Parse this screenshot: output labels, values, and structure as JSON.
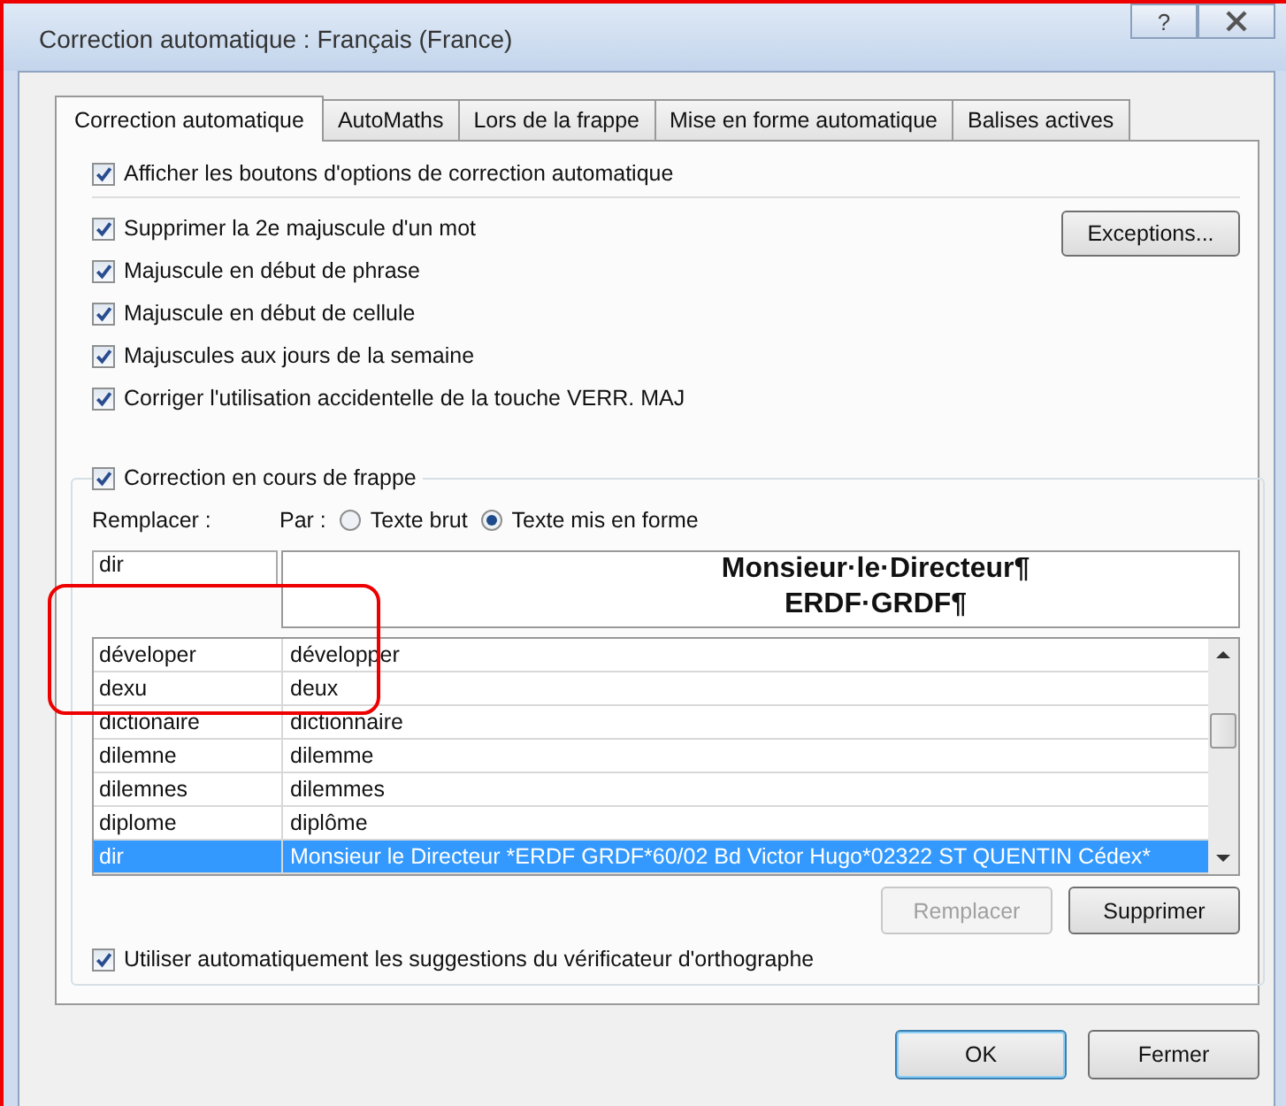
{
  "window": {
    "title": "Correction automatique : Français (France)",
    "help": "?"
  },
  "tabs": [
    {
      "label": "Correction automatique",
      "selected": true
    },
    {
      "label": "AutoMaths",
      "selected": false
    },
    {
      "label": "Lors de la frappe",
      "selected": false
    },
    {
      "label": "Mise en forme automatique",
      "selected": false
    },
    {
      "label": "Balises actives",
      "selected": false
    }
  ],
  "show_buttons": {
    "label": "Afficher les boutons d'options de correction automatique",
    "checked": true
  },
  "options": [
    {
      "label": "Supprimer la 2e majuscule d'un mot",
      "checked": true
    },
    {
      "label": "Majuscule en début de phrase",
      "checked": true
    },
    {
      "label": "Majuscule en début de cellule",
      "checked": true
    },
    {
      "label": "Majuscules aux jours de la semaine",
      "checked": true
    },
    {
      "label": "Corriger l'utilisation accidentelle de la touche VERR. MAJ",
      "checked": true
    }
  ],
  "exceptions_button": "Exceptions...",
  "typing": {
    "label": "Correction en cours de frappe",
    "checked": true,
    "replace_label": "Remplacer :",
    "with_label": "Par :",
    "radios": [
      {
        "label": "Texte brut",
        "selected": false
      },
      {
        "label": "Texte mis en forme",
        "selected": true
      }
    ],
    "replace_value": "dir",
    "preview_lines": [
      "Monsieur·le·Directeur¶",
      "ERDF·GRDF¶"
    ],
    "rows": [
      {
        "from": "déveloper",
        "to": "développer",
        "selected": false
      },
      {
        "from": "dexu",
        "to": "deux",
        "selected": false
      },
      {
        "from": "dictionaire",
        "to": "dictionnaire",
        "selected": false
      },
      {
        "from": "dilemne",
        "to": "dilemme",
        "selected": false
      },
      {
        "from": "dilemnes",
        "to": "dilemmes",
        "selected": false
      },
      {
        "from": "diplome",
        "to": "diplôme",
        "selected": false
      },
      {
        "from": "dir",
        "to": "Monsieur le Directeur *ERDF GRDF*60/02 Bd Victor Hugo*02322 ST QUENTIN Cédex*",
        "selected": true
      }
    ],
    "buttons": [
      {
        "label": "Remplacer",
        "disabled": true
      },
      {
        "label": "Supprimer",
        "disabled": false
      }
    ],
    "suggestions": {
      "label": "Utiliser automatiquement les suggestions du vérificateur d'orthographe",
      "checked": true
    }
  },
  "footer_buttons": [
    {
      "label": "OK",
      "default": true
    },
    {
      "label": "Fermer",
      "default": false
    }
  ]
}
